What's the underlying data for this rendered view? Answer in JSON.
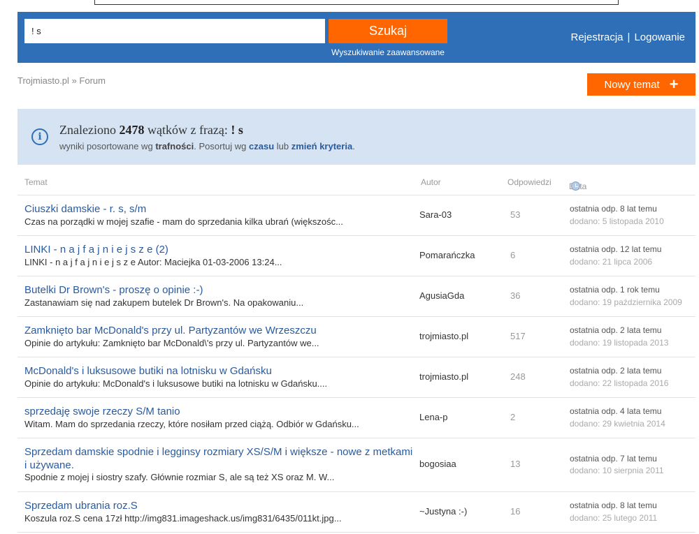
{
  "search": {
    "query": "! s",
    "button_label": "Szukaj",
    "advanced_link": "Wyszukiwanie zaawansowane"
  },
  "auth": {
    "register": "Rejestracja",
    "separator": "|",
    "login": "Logowanie"
  },
  "breadcrumb": {
    "home": "Trojmiasto.pl",
    "separator": "»",
    "current": "Forum"
  },
  "new_topic": {
    "label": "Nowy temat",
    "icon": "plus-icon"
  },
  "results": {
    "prefix": "Znaleziono",
    "count": "2478",
    "middle": "wątków z frazą:",
    "phrase": "! s",
    "sort_prefix": "wyniki posortowane wg",
    "sort_current": "trafności",
    "sort_mid": ". Posortuj wg",
    "sort_alt": "czasu",
    "sort_or": "lub",
    "change_criteria": "zmień kryteria",
    "sort_end": "."
  },
  "columns": {
    "topic": "Temat",
    "author": "Autor",
    "replies": "Odpowiedzi",
    "date": "Data"
  },
  "rows": [
    {
      "title": "Ciuszki damskie - r. s, s/m",
      "snippet": "Czas na porządki w mojej szafie - mam do sprzedania kilka ubrań (większośc...",
      "author": "Sara-03",
      "replies": "53",
      "last": "ostatnia odp. 8 lat temu",
      "added": "dodano: 5 listopada 2010"
    },
    {
      "title": "LINKI - n a j f a j n i e j s z e (2)",
      "snippet": "LINKI - n a j f a j n i e j s z e Autor: Maciejka 01-03-2006 13:24...",
      "author": "Pomarańczka",
      "replies": "6",
      "last": "ostatnia odp. 12 lat temu",
      "added": "dodano: 21 lipca 2006"
    },
    {
      "title": "Butelki Dr Brown's - proszę o opinie :-)",
      "snippet": "Zastanawiam się nad zakupem butelek Dr Brown's. Na opakowaniu...",
      "author": "AgusiaGda",
      "replies": "36",
      "last": "ostatnia odp. 1 rok temu",
      "added": "dodano: 19 października 2009"
    },
    {
      "title": "Zamknięto bar McDonald's przy ul. Partyzantów we Wrzeszczu",
      "snippet": "Opinie do artykułu: Zamknięto bar McDonald\\'s przy ul. Partyzantów we...",
      "author": "trojmiasto.pl",
      "replies": "517",
      "last": "ostatnia odp. 2 lata temu",
      "added": "dodano: 19 listopada 2013"
    },
    {
      "title": "McDonald's i luksusowe butiki na lotnisku w Gdańsku",
      "snippet": "Opinie do artykułu: McDonald's i luksusowe butiki na lotnisku w Gdańsku....",
      "author": "trojmiasto.pl",
      "replies": "248",
      "last": "ostatnia odp. 2 lata temu",
      "added": "dodano: 22 listopada 2016"
    },
    {
      "title": "sprzedaję swoje rzeczy S/M tanio",
      "snippet": "Witam. Mam do sprzedania rzeczy, które nosiłam przed ciążą. Odbiór w Gdańsku...",
      "author": "Lena-p",
      "replies": "2",
      "last": "ostatnia odp. 4 lata temu",
      "added": "dodano: 29 kwietnia 2014"
    },
    {
      "title": "Sprzedam damskie spodnie i legginsy rozmiary XS/S/M i większe - nowe z metkami i używane.",
      "snippet": "Spodnie z mojej i siostry szafy. Głównie rozmiar S, ale są też XS oraz M. W...",
      "author": "bogosiaa",
      "replies": "13",
      "last": "ostatnia odp. 7 lat temu",
      "added": "dodano: 10 sierpnia 2011"
    },
    {
      "title": "Sprzedam ubrania roz.S",
      "snippet": "Koszula roz.S cena 17zł http://img831.imageshack.us/img831/6435/011kt.jpg...",
      "author": "~Justyna :-)",
      "replies": "16",
      "last": "ostatnia odp. 8 lat temu",
      "added": "dodano: 25 lutego 2011"
    }
  ]
}
